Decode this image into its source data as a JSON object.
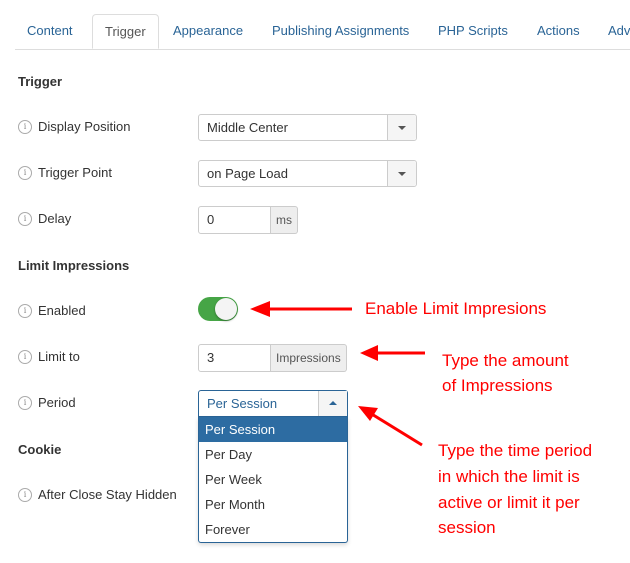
{
  "tabs": [
    {
      "label": "Content",
      "active": false
    },
    {
      "label": "Trigger",
      "active": true
    },
    {
      "label": "Appearance",
      "active": false
    },
    {
      "label": "Publishing Assignments",
      "active": false
    },
    {
      "label": "PHP Scripts",
      "active": false
    },
    {
      "label": "Actions",
      "active": false
    },
    {
      "label": "Adv",
      "active": false
    }
  ],
  "trigger": {
    "heading": "Trigger",
    "display_position": {
      "label": "Display Position",
      "value": "Middle Center"
    },
    "trigger_point": {
      "label": "Trigger Point",
      "value": "on Page Load"
    },
    "delay": {
      "label": "Delay",
      "value": "0",
      "unit": "ms"
    }
  },
  "limit": {
    "heading": "Limit Impressions",
    "enabled": {
      "label": "Enabled",
      "value": true,
      "color": "#46a546"
    },
    "limit_to": {
      "label": "Limit to",
      "value": "3",
      "unit": "Impressions"
    },
    "period": {
      "label": "Period",
      "value": "Per Session",
      "options": [
        "Per Session",
        "Per Day",
        "Per Week",
        "Per Month",
        "Forever"
      ]
    }
  },
  "cookie": {
    "heading": "Cookie",
    "after_close": {
      "label": "After Close Stay Hidden"
    }
  },
  "annotations": {
    "enable": "Enable Limit Impresions",
    "amount_1": "Type the amount",
    "amount_2": "of Impressions",
    "period_1": "Type the time period",
    "period_2": "in which the limit is",
    "period_3": "active or limit it per",
    "period_4": "session",
    "color": "#ff0000"
  },
  "info_icon": "i"
}
